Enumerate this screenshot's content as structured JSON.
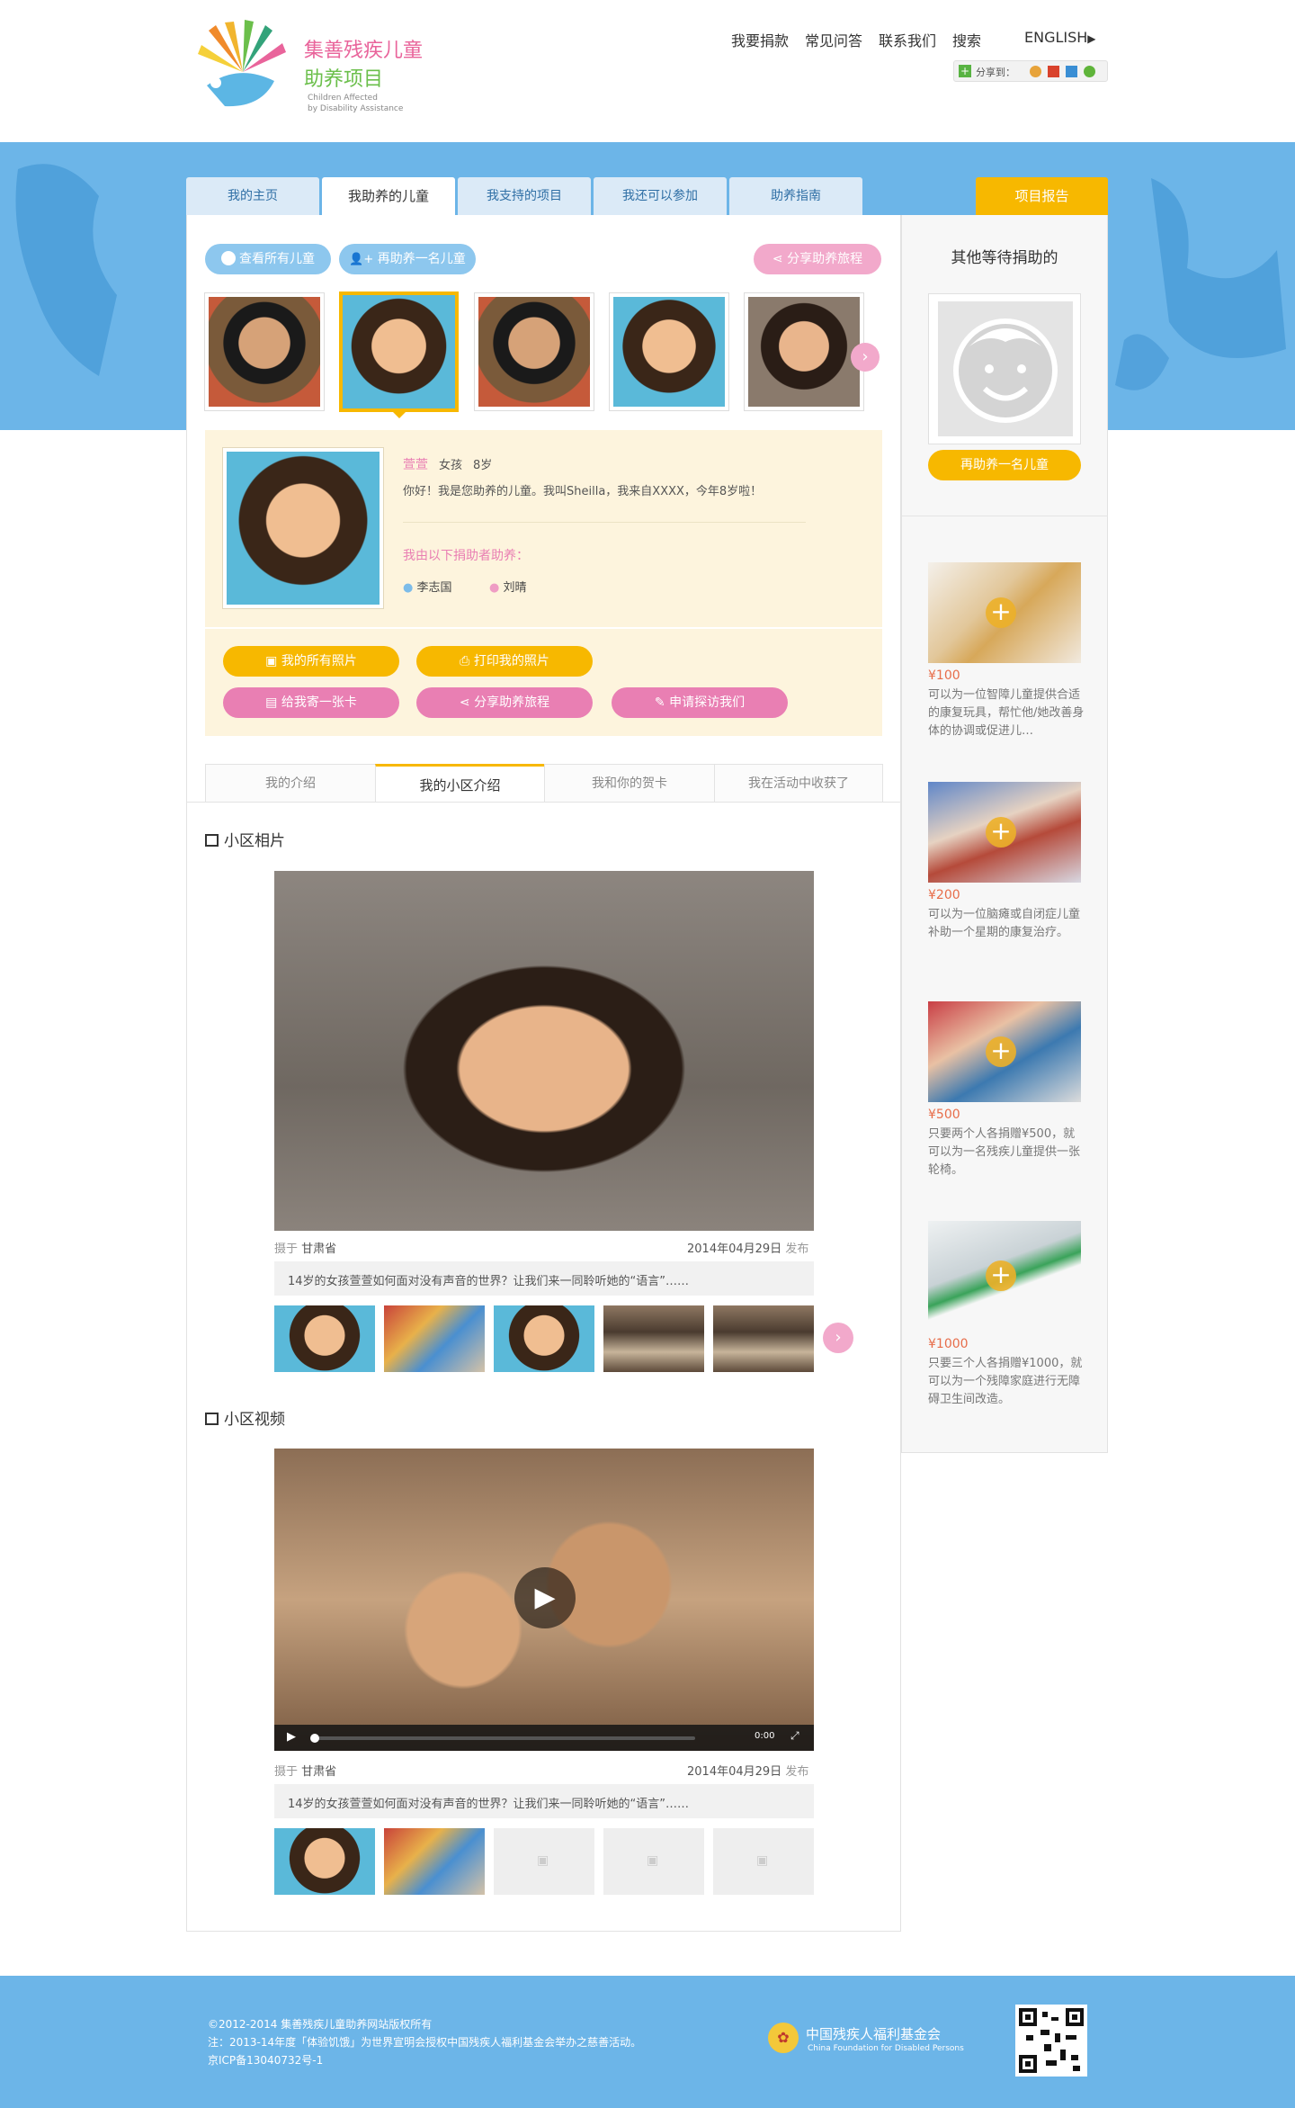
{
  "logo": {
    "title_line1": "集善残疾儿童",
    "title_line2": "助养项目",
    "en_line1": "Children Affected",
    "en_line2": "by Disability Assistance"
  },
  "topnav": {
    "items": [
      "我要捐款",
      "常见问答",
      "联系我们",
      "搜索"
    ],
    "english": "ENGLISH"
  },
  "share": {
    "label": "分享到："
  },
  "tabs": [
    "我的主页",
    "我助养的儿童",
    "我支持的项目",
    "我还可以参加",
    "助养指南"
  ],
  "report_tab": "项目报告",
  "actions": {
    "view_all": "查看所有儿童",
    "sponsor_another": "再助养一名儿童",
    "share_journey": "分享助养旅程"
  },
  "child": {
    "name": "萱萱",
    "gender": "女孩",
    "age": "8岁",
    "intro": "你好！我是您助养的儿童。我叫Sheilla，我来自XXXX，今年8岁啦！",
    "sponsored_by": "我由以下捐助者助养：",
    "sponsors": [
      "李志国",
      "刘晴"
    ]
  },
  "buttons": {
    "all_photos": "我的所有照片",
    "print_photos": "打印我的照片",
    "send_card": "给我寄一张卡",
    "share_journey": "分享助养旅程",
    "visit_request": "申请探访我们"
  },
  "subtabs": [
    "我的介绍",
    "我的小区介绍",
    "我和你的贺卡",
    "我在活动中收获了"
  ],
  "photos": {
    "section_title": "小区相片",
    "location_prefix": "摄于",
    "location": "甘肃省",
    "date": "2014年04月29日",
    "date_suffix": "发布",
    "caption": "14岁的女孩萱萱如何面对没有声音的世界？让我们来一同聆听她的“语言”……"
  },
  "videos": {
    "section_title": "小区视频",
    "location_prefix": "摄于",
    "location": "甘肃省",
    "date": "2014年04月29日",
    "date_suffix": "发布",
    "caption": "14岁的女孩萱萱如何面对没有声音的世界？让我们来一同聆听她的“语言”……",
    "time": "0:00",
    "progress": 0
  },
  "sidebar": {
    "title": "其他等待捐助的",
    "cta": "再助养一名儿童",
    "items": [
      {
        "amount": "¥100",
        "desc": "可以为一位智障儿童提供合适的康复玩具，帮忙他/她改善身体的协调或促进儿…"
      },
      {
        "amount": "¥200",
        "desc": "可以为一位脑瘫或自闭症儿童补助一个星期的康复治疗。"
      },
      {
        "amount": "¥500",
        "desc": "只要两个人各捐赠¥500，就可以为一名残疾儿童提供一张轮椅。"
      },
      {
        "amount": "¥1000",
        "desc": "只要三个人各捐赠¥1000，就可以为一个残障家庭进行无障碍卫生间改造。"
      }
    ]
  },
  "footer": {
    "copyright": "©2012-2014 集善残疾儿童助养网站版权所有",
    "note": "注：2013-14年度「体验饥饿」为世界宣明会授权中国残疾人福利基金会举办之慈善活动。",
    "icp": "京ICP备13040732号-1",
    "org_cn": "中国残疾人福利基金会",
    "org_en": "China Foundation for Disabled Persons"
  },
  "colors": {
    "blue": "#6cb5e8",
    "yellow": "#f7b800",
    "pink": "#e97fb3",
    "cream": "#fdf4dd"
  }
}
